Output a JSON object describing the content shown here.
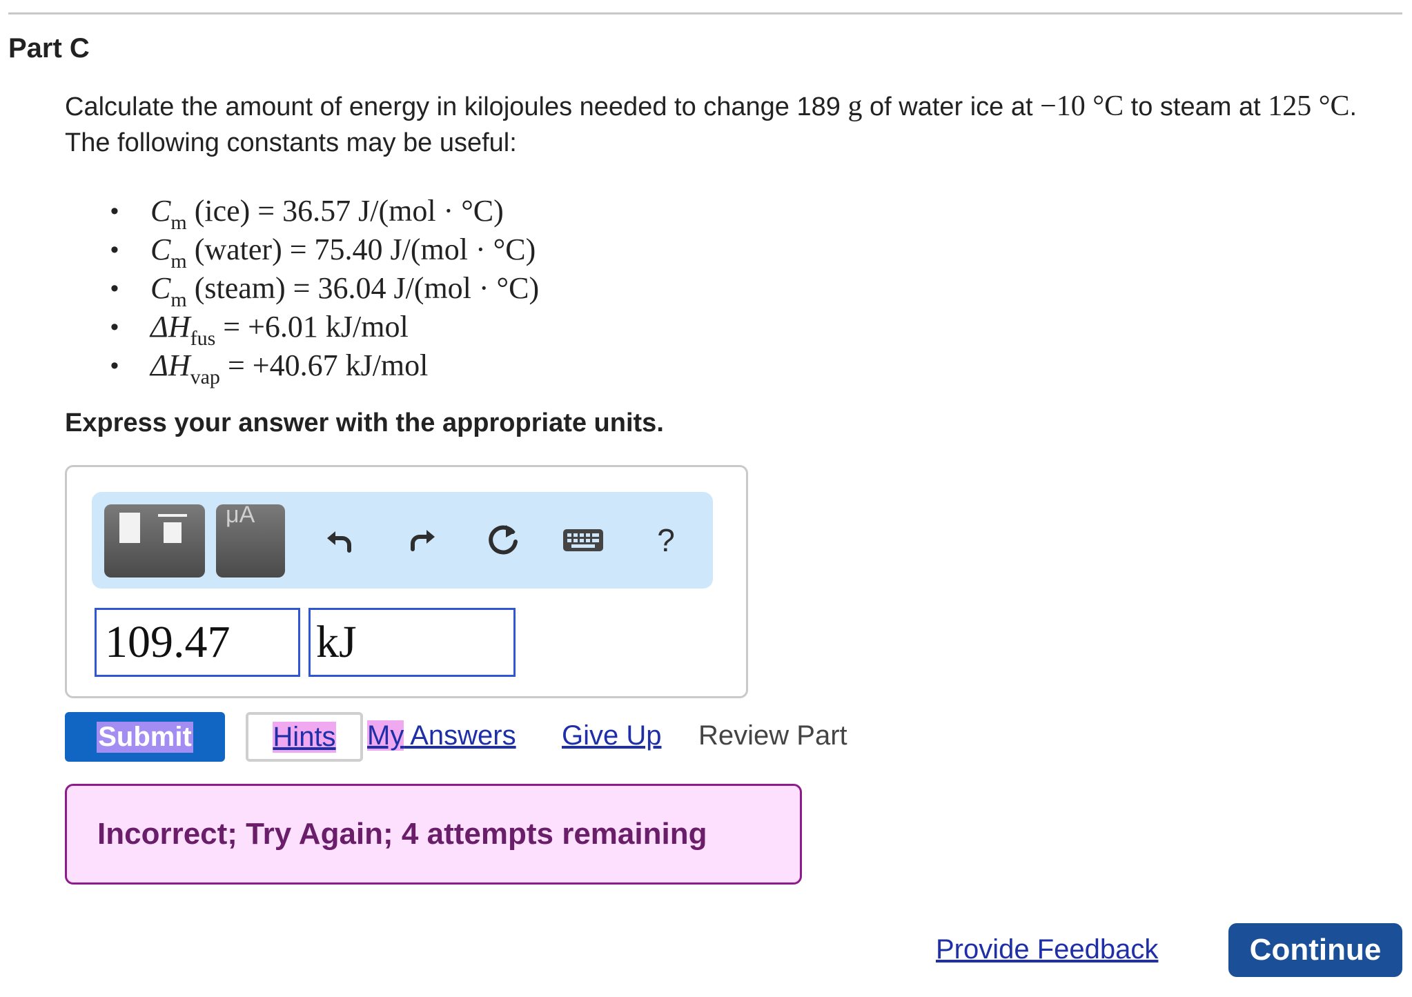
{
  "part": {
    "title": "Part C"
  },
  "question": {
    "text_1": "Calculate the amount of energy in kilojoules needed to change 189 ",
    "mass_unit": "g",
    "text_2": " of water ice at ",
    "start_temp": "−10 °C",
    "text_3": " to steam at ",
    "end_temp": "125 °C",
    "text_4": ". The following constants may be useful:"
  },
  "constants": [
    {
      "symbol": "C",
      "sub": "m",
      "rest": " (ice) = 36.57 J/(mol · °C)"
    },
    {
      "symbol": "C",
      "sub": "m",
      "rest": " (water) = 75.40 J/(mol · °C)"
    },
    {
      "symbol": "C",
      "sub": "m",
      "rest": " (steam) = 36.04 J/(mol · °C)"
    },
    {
      "symbol": "ΔH",
      "sub": "fus",
      "rest": " = +6.01 kJ/mol"
    },
    {
      "symbol": "ΔH",
      "sub": "vap",
      "rest": " = +40.67 kJ/mol"
    }
  ],
  "instructions": "Express your answer with the appropriate units.",
  "toolbar": {
    "units_tile_label": "μA",
    "help_label": "?",
    "icons": [
      "templates-icon",
      "units-icon",
      "undo-icon",
      "redo-icon",
      "reset-icon",
      "keyboard-icon",
      "help-icon"
    ]
  },
  "answer": {
    "value": "109.47",
    "unit": "kJ"
  },
  "actions": {
    "submit": "Submit",
    "hints": "Hints",
    "my_answers_a": "My",
    "my_answers_b": " Answers",
    "give_up": "Give Up",
    "review_part": "Review Part"
  },
  "feedback": {
    "message": "Incorrect; Try Again; 4 attempts remaining"
  },
  "footer": {
    "provide_feedback": "Provide Feedback",
    "continue": "Continue"
  },
  "colors": {
    "submit_bg": "#1166c4",
    "toolbar_bg": "#cfe7fb",
    "field_border": "#2f56d6",
    "feedback_bg": "#fde0fd",
    "feedback_border": "#8c1c8c",
    "link": "#1e2fa8",
    "continue_bg": "#1b4f97"
  }
}
